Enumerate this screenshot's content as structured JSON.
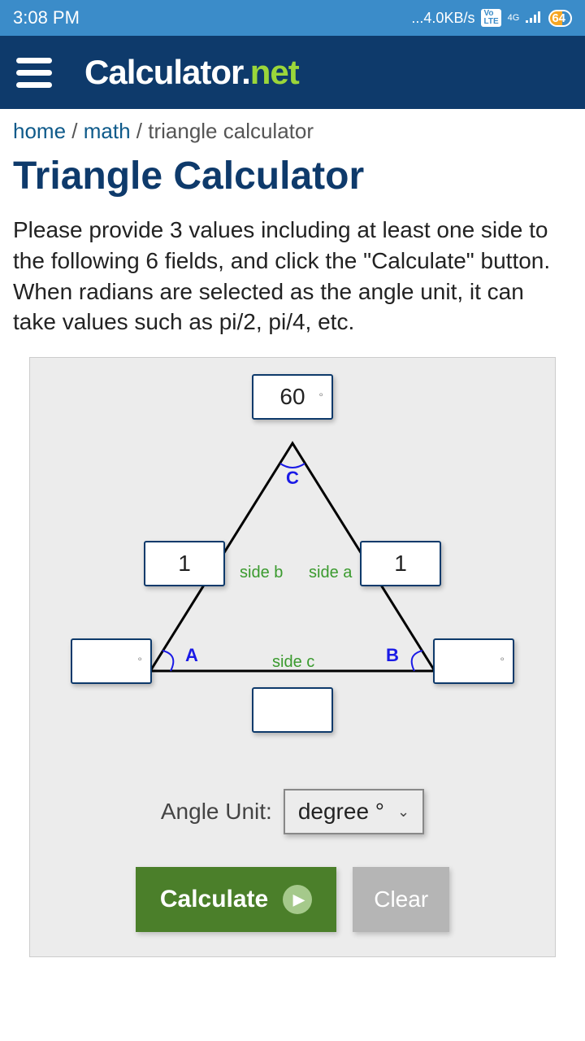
{
  "status": {
    "time": "3:08 PM",
    "speed": "...4.0KB/s",
    "volte": "VoLTE",
    "network": "4G",
    "battery": "64"
  },
  "header": {
    "logo_main": "Calculator.",
    "logo_ext": "net"
  },
  "breadcrumb": {
    "home": "home",
    "math": "math",
    "current": "triangle calculator"
  },
  "page": {
    "title": "Triangle Calculator",
    "instructions": "Please provide 3 values including at least one side to the following 6 fields, and click the \"Calculate\" button. When radians are selected as the angle unit, it can take values such as pi/2, pi/4, etc."
  },
  "triangle": {
    "angle_C": "60",
    "side_b": "1",
    "side_a": "1",
    "angle_A": "",
    "angle_B": "",
    "side_c": "",
    "label_C": "C",
    "label_A": "A",
    "label_B": "B",
    "label_side_a": "side a",
    "label_side_b": "side b",
    "label_side_c": "side c"
  },
  "angle_unit": {
    "label": "Angle Unit:",
    "selected": "degree °"
  },
  "buttons": {
    "calculate": "Calculate",
    "clear": "Clear"
  }
}
